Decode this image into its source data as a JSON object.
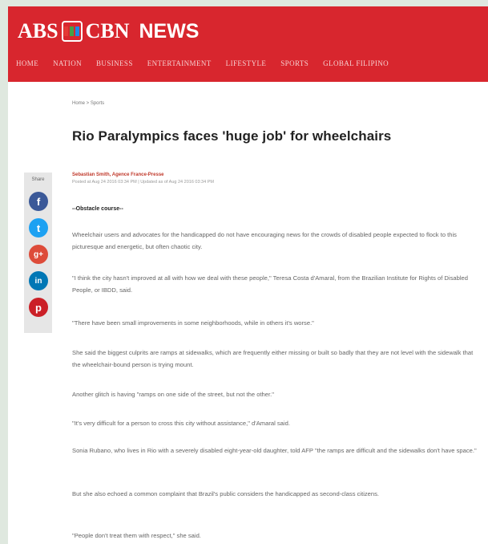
{
  "site": {
    "logo_abs": "ABS",
    "logo_cbn": "CBN",
    "logo_news": "NEWS",
    "brand_color": "#d8262e"
  },
  "nav": [
    "HOME",
    "NATION",
    "BUSINESS",
    "ENTERTAINMENT",
    "LIFESTYLE",
    "SPORTS",
    "GLOBAL FILIPINO"
  ],
  "breadcrumb": "Home  >  Sports",
  "article": {
    "title": "Rio Paralympics faces 'huge job' for wheelchairs",
    "byline": "Sebastian Smith, Agence France-Presse",
    "dateline": "Posted at Aug 24 2016 03:34 PM | Updated as of Aug 24 2016 03:34 PM",
    "subhead": "--Obstacle course--",
    "paragraphs": [
      "Wheelchair users and advocates for the handicapped do not have encouraging news for the crowds of disabled people expected to flock to this picturesque and energetic, but often chaotic city.",
      "\"I think the city hasn't improved at all with how we deal with these people,\" Teresa Costa d'Amaral, from the Brazilian Institute for Rights of Disabled People, or IBDD, said.",
      "\"There have been small improvements in some neighborhoods, while in others it's worse.\"",
      "She said the biggest culprits are ramps at sidewalks, which are frequently either missing or built so badly that they are not level with the sidewalk that the wheelchair-bound person is trying mount.",
      "Another glitch is having \"ramps on one side of the street, but not the other.\"",
      "\"It's very difficult for a person to cross this city without assistance,\" d'Amaral said.",
      "Sonia Rubano, who lives in Rio with a severely disabled eight-year-old daughter, told AFP \"the ramps are difficult and the sidewalks don't have space.\"",
      "But she also echoed a common complaint that Brazil's public considers the handicapped as second-class citizens.",
      "\"People don't treat them with respect,\" she said."
    ]
  },
  "share": {
    "label": "Share",
    "buttons": [
      {
        "name": "facebook-icon",
        "glyph": "f",
        "color": "#3b5998"
      },
      {
        "name": "twitter-icon",
        "glyph": "t",
        "color": "#1da1f2"
      },
      {
        "name": "google-plus-icon",
        "glyph": "g+",
        "color": "#dd4b39"
      },
      {
        "name": "linkedin-icon",
        "glyph": "in",
        "color": "#0077b5"
      },
      {
        "name": "pinterest-icon",
        "glyph": "p",
        "color": "#cb2027"
      }
    ]
  }
}
